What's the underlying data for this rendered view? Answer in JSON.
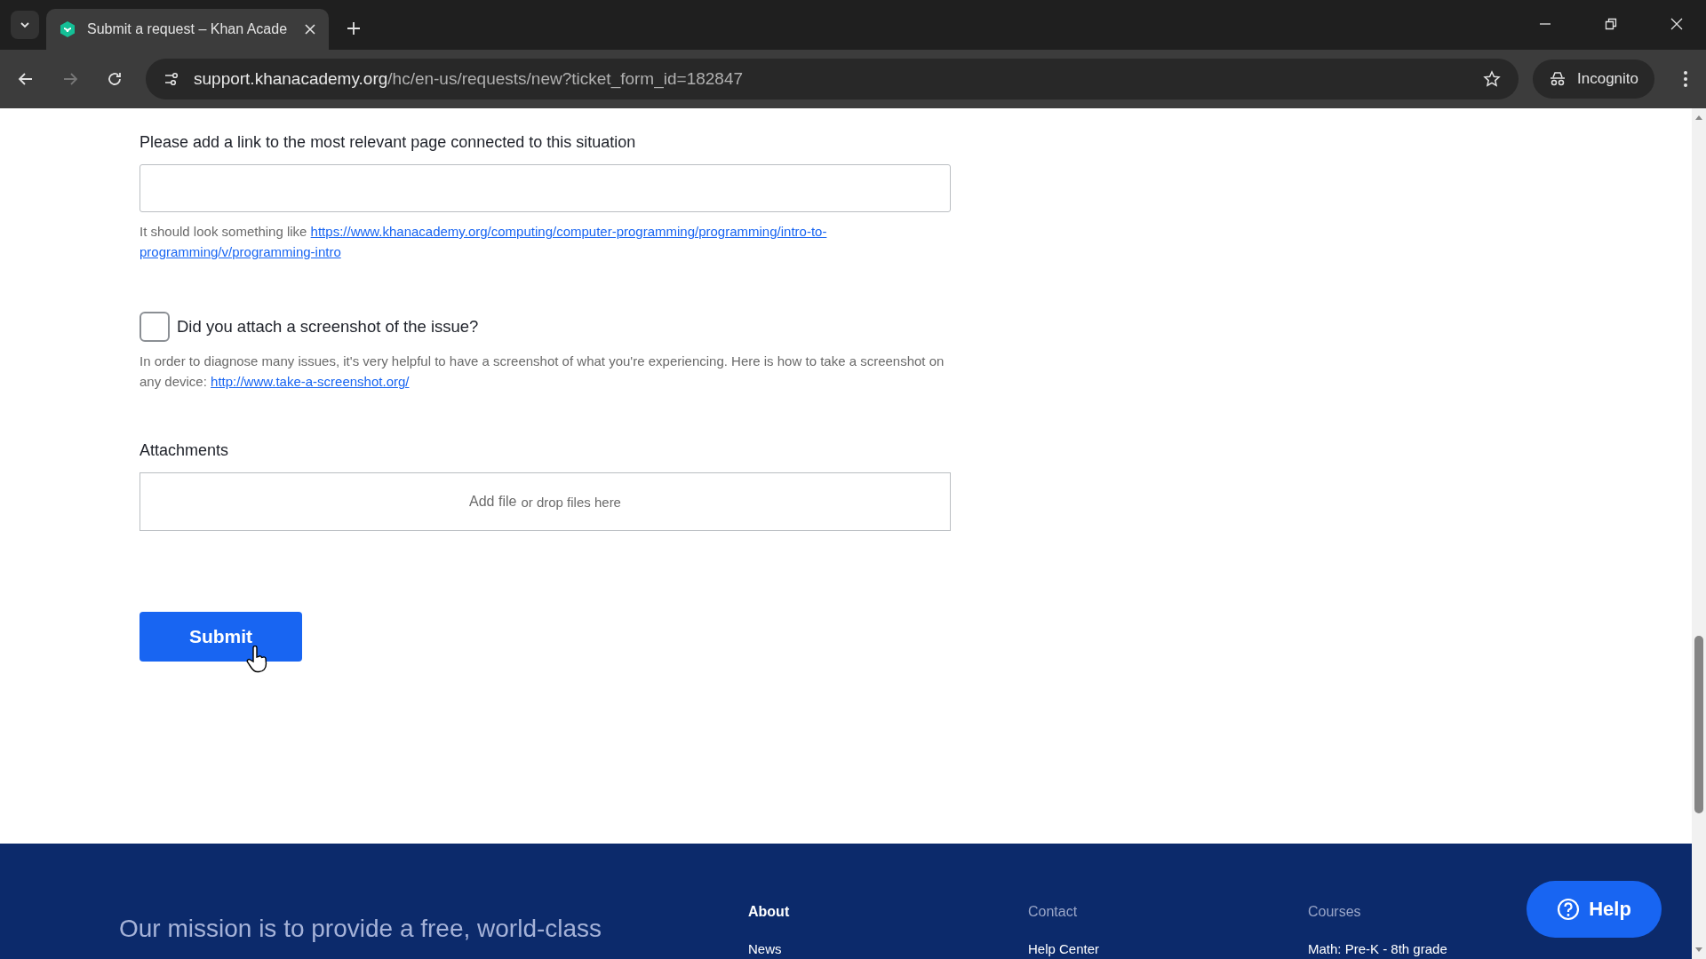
{
  "browser": {
    "tab_title": "Submit a request – Khan Acade",
    "url_host": "support.khanacademy.org",
    "url_path": "/hc/en-us/requests/new?ticket_form_id=182847",
    "profile": "Incognito"
  },
  "form": {
    "link_field": {
      "label": "Please add a link to the most relevant page connected to this situation"
    },
    "link_hint": {
      "text": "It should look something like ",
      "link_lines": [
        "https://www.khanacademy.org/computing/computer-programming/programming/intro-to-",
        "programming/v/programming-intro"
      ]
    },
    "screenshot_checkbox": {
      "label": "Did you attach a screenshot of the issue?",
      "checked": false
    },
    "screenshot_hint": {
      "text": "In order to diagnose many issues, it's very helpful to have a screenshot of what you're experiencing. Here is how to take a screenshot on any device: ",
      "link": "http://www.take-a-screenshot.org/"
    },
    "attachments": {
      "label": "Attachments",
      "add_link": "Add file",
      "drop_text": "or drop files here"
    },
    "submit": "Submit"
  },
  "footer": {
    "mission": "Our mission is to provide a free, world-class",
    "columns": [
      {
        "heading": "About",
        "active": true,
        "items": [
          "News"
        ]
      },
      {
        "heading": "Contact",
        "active": false,
        "items": [
          "Help Center"
        ]
      },
      {
        "heading": "Courses",
        "active": false,
        "items": [
          "Math: Pre-K - 8th grade"
        ]
      }
    ],
    "help_button": "Help"
  }
}
